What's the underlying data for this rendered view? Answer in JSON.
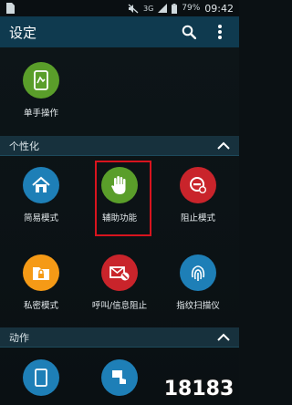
{
  "status_bar": {
    "network": "3G",
    "battery": "79%",
    "time": "09:42"
  },
  "action_bar": {
    "title": "设定"
  },
  "top_items": [
    {
      "label": "单手操作",
      "icon": "one-hand-icon"
    }
  ],
  "sections": [
    {
      "header": "个性化",
      "items": [
        {
          "label": "简易模式",
          "icon": "easy-home-icon"
        },
        {
          "label": "辅助功能",
          "icon": "hand-icon"
        },
        {
          "label": "阻止模式",
          "icon": "block-icon"
        },
        {
          "label": "私密模式",
          "icon": "private-folder-icon"
        },
        {
          "label": "呼叫/信息阻止",
          "icon": "call-block-icon"
        },
        {
          "label": "指纹扫描仪",
          "icon": "fingerprint-icon"
        }
      ]
    },
    {
      "header": "动作",
      "items": []
    }
  ],
  "watermark": "18183",
  "colors": {
    "action_bar": "#0f3a4f",
    "section_header": "#17313d",
    "green": "#5a9e2a",
    "blue": "#1e7fb7",
    "orange": "#f59a16",
    "red": "#c9242b",
    "highlight": "#d8141e"
  }
}
